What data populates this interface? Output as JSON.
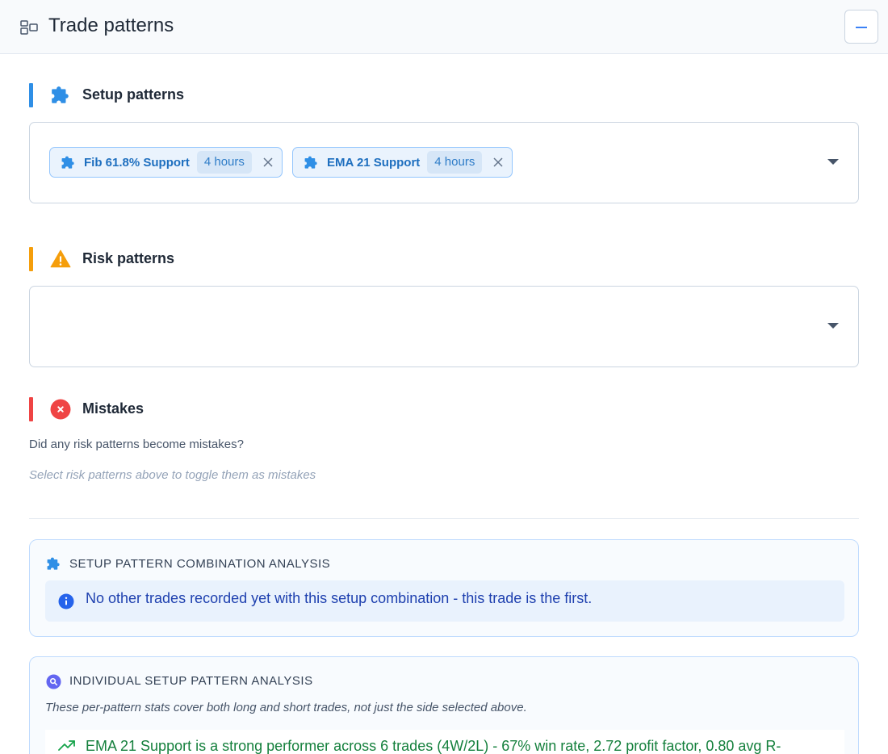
{
  "header": {
    "title": "Trade patterns",
    "icon": "layout-icon",
    "collapse_icon": "minus-icon"
  },
  "setup": {
    "title": "Setup patterns",
    "accent": "#2f8fe6",
    "icon": "puzzle-icon",
    "chips": [
      {
        "label": "Fib 61.8% Support",
        "badge": "4 hours"
      },
      {
        "label": "EMA 21 Support",
        "badge": "4 hours"
      }
    ]
  },
  "risk": {
    "title": "Risk patterns",
    "accent": "#f59e0b",
    "icon": "warning-icon"
  },
  "mistakes": {
    "title": "Mistakes",
    "accent": "#ef4444",
    "icon": "x-circle-icon",
    "question": "Did any risk patterns become mistakes?",
    "hint": "Select risk patterns above to toggle them as mistakes"
  },
  "combo_card": {
    "title": "SETUP PATTERN COMBINATION ANALYSIS",
    "message": "No other trades recorded yet with this setup combination - this trade is the first."
  },
  "individual_card": {
    "title": "INDIVIDUAL SETUP PATTERN ANALYSIS",
    "note": "These per-pattern stats cover both long and short trades, not just the side selected above.",
    "insights": [
      {
        "text": "EMA 21 Support is a strong performer across 6 trades (4W/2L) - 67% win rate, 2.72 profit factor, 0.80 avg R-"
      }
    ]
  }
}
